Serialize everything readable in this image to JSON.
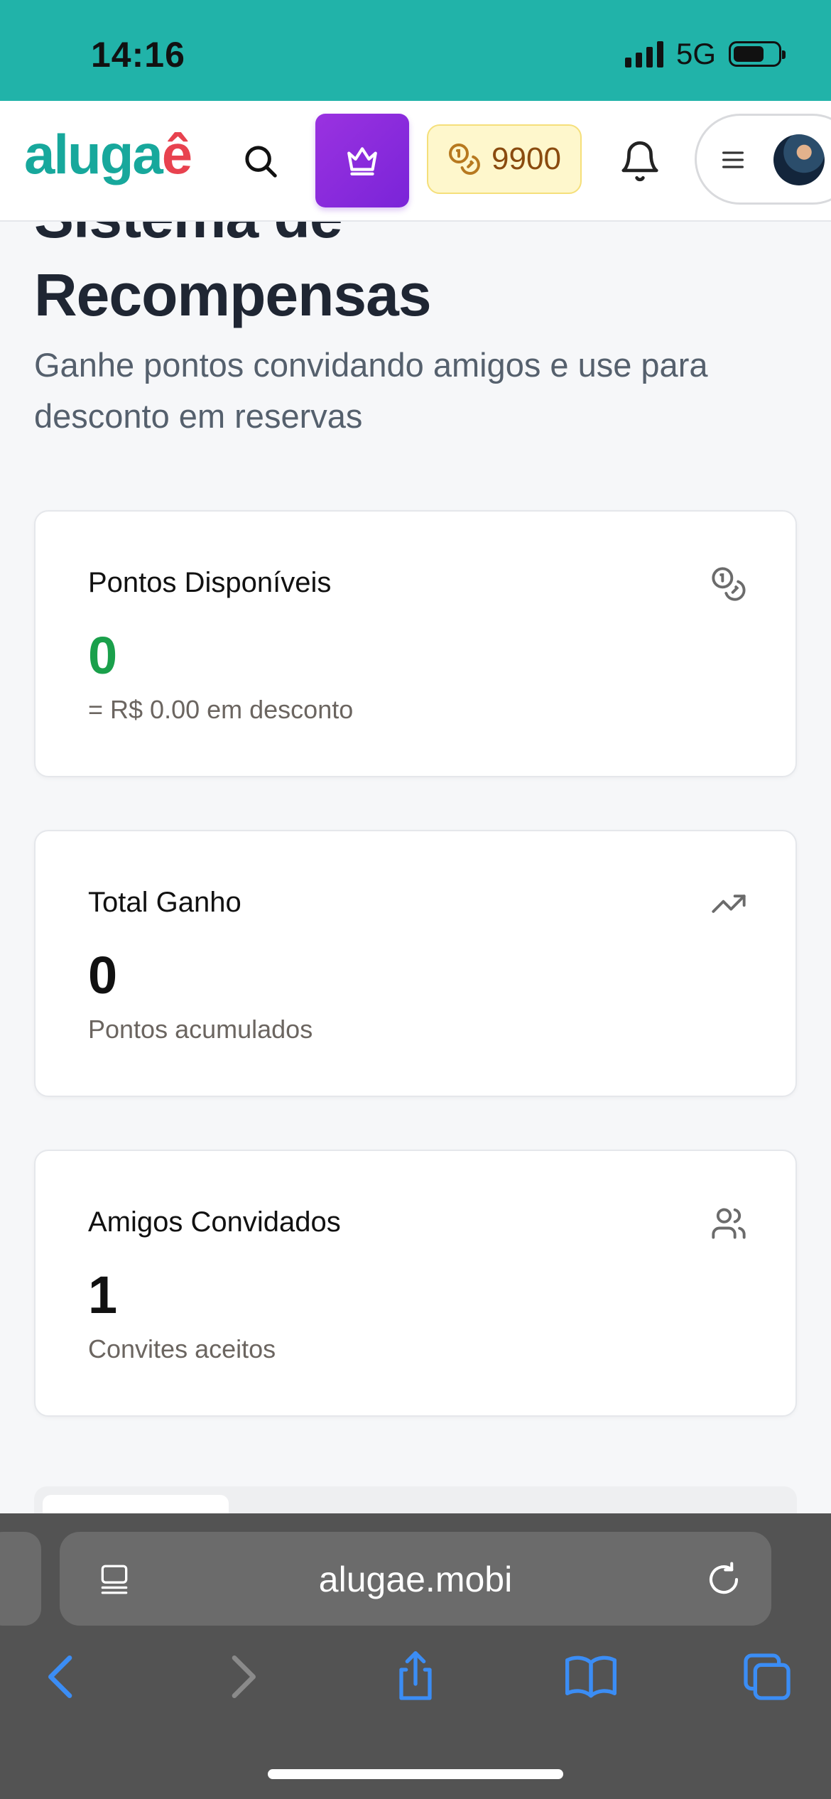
{
  "status_bar": {
    "time": "14:16",
    "network": "5G"
  },
  "header": {
    "logo_part1": "aluga",
    "logo_part2": "ê",
    "points_value": "9900",
    "icons": [
      "search-icon",
      "crown-icon",
      "coins-icon",
      "bell-icon",
      "menu-icon",
      "avatar"
    ]
  },
  "page": {
    "title_line1": "Sistema de",
    "title_line2": "Recompensas",
    "subtitle": "Ganhe pontos convidando amigos e use para desconto em reservas"
  },
  "cards": [
    {
      "label": "Pontos Disponíveis",
      "value": "0",
      "caption": "= R$ 0.00 em desconto",
      "icon": "coins-icon",
      "value_color": "#1aa04b"
    },
    {
      "label": "Total Ganho",
      "value": "0",
      "caption": "Pontos acumulados",
      "icon": "trending-up-icon"
    },
    {
      "label": "Amigos Convidados",
      "value": "1",
      "caption": "Convites aceitos",
      "icon": "users-icon"
    }
  ],
  "browser": {
    "url": "alugae.mobi"
  },
  "colors": {
    "brand_teal": "#17a89c",
    "brand_red": "#e8424f",
    "premium_purple": "#8a2be2",
    "points_bg": "#fef7cc"
  }
}
